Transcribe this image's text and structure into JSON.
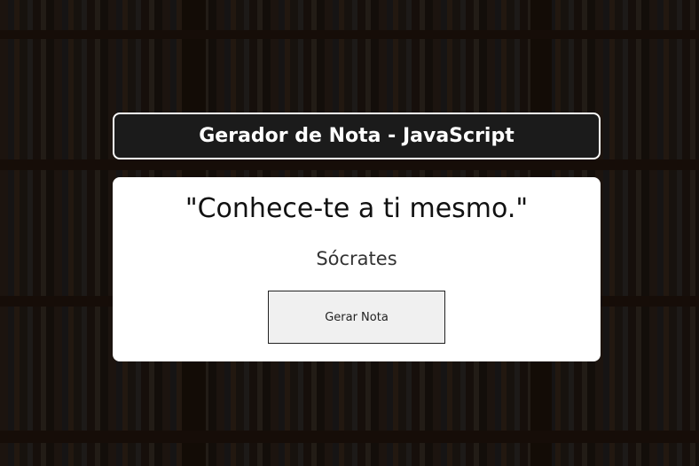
{
  "header": {
    "title": "Gerador de Nota - JavaScript"
  },
  "card": {
    "quote": "\"Conhece-te a ti mesmo.\"",
    "author": "Sócrates",
    "button_label": "Gerar Nota"
  }
}
